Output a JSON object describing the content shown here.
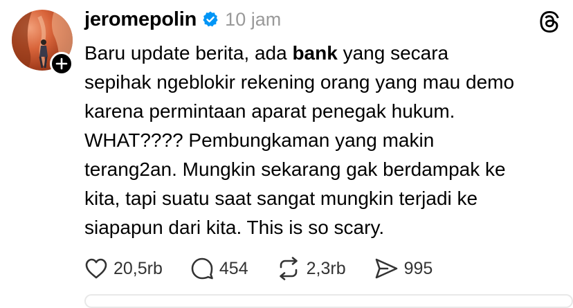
{
  "post": {
    "author": {
      "username": "jeromepolin",
      "verified": true,
      "avatar_icon": "avatar-photo",
      "follow_icon": "plus-icon"
    },
    "timestamp": "10 jam",
    "app_icon": "threads-logo-icon",
    "text_before_bold": "Baru update berita, ada ",
    "text_bold": "bank",
    "text_after_bold": " yang secara\nsepihak ngeblokir rekening orang yang mau demo\nkarena permintaan aparat penegak hukum.\nWHAT???? Pembungkaman yang makin\nterang2an. Mungkin sekarang gak berdampak ke\nkita, tapi suatu saat sangat mungkin terjadi ke\nsiapapun dari kita. This is so scary.",
    "actions": {
      "like": {
        "icon": "heart-icon",
        "count": "20,5rb"
      },
      "reply": {
        "icon": "comment-icon",
        "count": "454"
      },
      "repost": {
        "icon": "repost-icon",
        "count": "2,3rb"
      },
      "share": {
        "icon": "send-icon",
        "count": "995"
      }
    },
    "colors": {
      "verified_blue": "#0095F6",
      "text": "#000000",
      "muted": "#999999"
    }
  }
}
